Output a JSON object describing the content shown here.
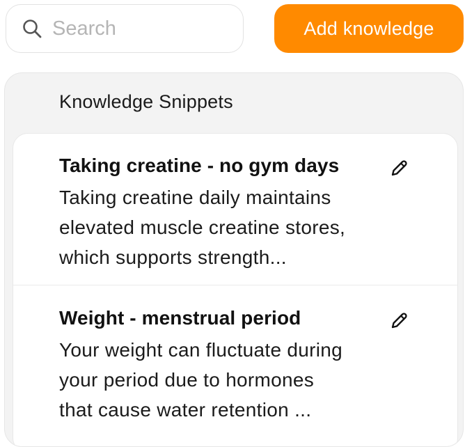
{
  "search": {
    "placeholder": "Search",
    "icon": "search-icon"
  },
  "toolbar": {
    "add_label": "Add knowledge",
    "accent_color": "#ff8a00"
  },
  "panel": {
    "title": "Knowledge Snippets"
  },
  "snippets": [
    {
      "title": "Taking creatine - no gym days",
      "body": "Taking creatine daily maintains\nelevated muscle creatine stores,\nwhich supports strength...",
      "icon": "pencil-icon"
    },
    {
      "title": "Weight - menstrual period",
      "body": "Your weight can fluctuate during\nyour period due to hormones\nthat cause water retention ...",
      "icon": "pencil-icon"
    }
  ]
}
